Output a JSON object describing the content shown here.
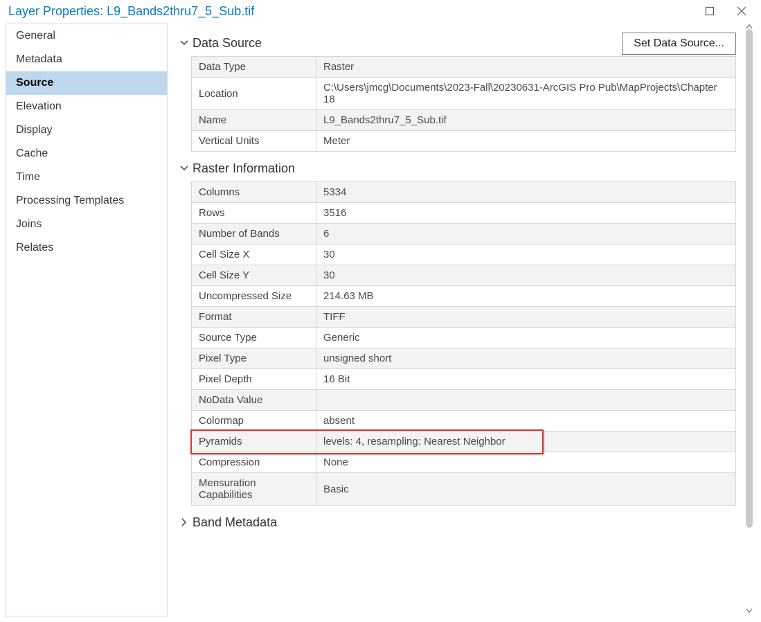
{
  "window": {
    "title": "Layer Properties: L9_Bands2thru7_5_Sub.tif"
  },
  "sidebar": {
    "items": [
      {
        "label": "General"
      },
      {
        "label": "Metadata"
      },
      {
        "label": "Source",
        "active": true
      },
      {
        "label": "Elevation"
      },
      {
        "label": "Display"
      },
      {
        "label": "Cache"
      },
      {
        "label": "Time"
      },
      {
        "label": "Processing Templates"
      },
      {
        "label": "Joins"
      },
      {
        "label": "Relates"
      }
    ]
  },
  "buttons": {
    "set_data_source": "Set Data Source..."
  },
  "sections": {
    "data_source": {
      "title": "Data Source",
      "rows": [
        {
          "k": "Data Type",
          "v": "Raster"
        },
        {
          "k": "Location",
          "v": "C:\\Users\\jmcg\\Documents\\2023-Fall\\20230631-ArcGIS Pro Pub\\MapProjects\\Chapter 18"
        },
        {
          "k": "Name",
          "v": "L9_Bands2thru7_5_Sub.tif"
        },
        {
          "k": "Vertical Units",
          "v": "Meter"
        }
      ]
    },
    "raster_info": {
      "title": "Raster Information",
      "rows": [
        {
          "k": "Columns",
          "v": "5334"
        },
        {
          "k": "Rows",
          "v": "3516"
        },
        {
          "k": "Number of Bands",
          "v": "6"
        },
        {
          "k": "Cell Size X",
          "v": "30"
        },
        {
          "k": "Cell Size Y",
          "v": "30"
        },
        {
          "k": "Uncompressed Size",
          "v": "214.63 MB"
        },
        {
          "k": "Format",
          "v": "TIFF"
        },
        {
          "k": "Source Type",
          "v": "Generic"
        },
        {
          "k": "Pixel Type",
          "v": "unsigned short"
        },
        {
          "k": "Pixel Depth",
          "v": "16 Bit"
        },
        {
          "k": "NoData Value",
          "v": ""
        },
        {
          "k": "Colormap",
          "v": "absent"
        },
        {
          "k": "Pyramids",
          "v": "levels: 4, resampling: Nearest Neighbor"
        },
        {
          "k": "Compression",
          "v": "None"
        },
        {
          "k": "Mensuration Capabilities",
          "v": "Basic"
        }
      ]
    },
    "band_metadata": {
      "title": "Band Metadata"
    }
  }
}
